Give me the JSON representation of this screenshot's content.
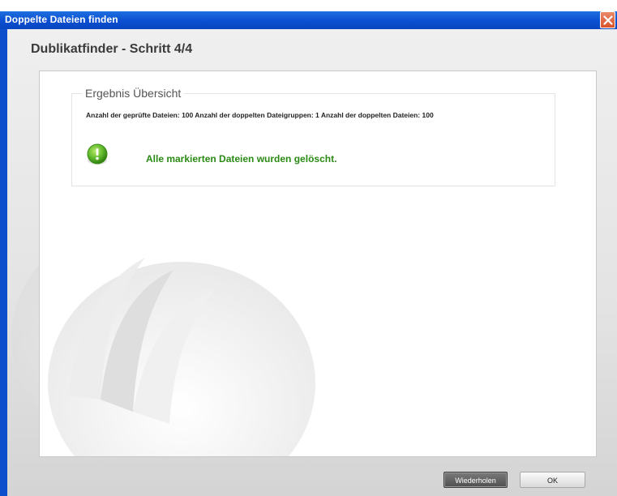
{
  "window": {
    "title": "Doppelte Dateien finden"
  },
  "wizard": {
    "heading": "Dublikatfinder - Schritt 4/4"
  },
  "result": {
    "legend": "Ergebnis Übersicht",
    "stats_text": "Anzahl der geprüfte Dateien: 100   Anzahl der doppelten Dateigruppen: 1   Anzahl der doppelten Dateien: 100",
    "status_message": "Alle markierten Dateien wurden gelöscht.",
    "status_icon": "exclamation-icon"
  },
  "buttons": {
    "repeat_label": "Wiederholen",
    "ok_label": "OK"
  },
  "colors": {
    "titlebar": "#0a4fd0",
    "success_text": "#2a8a14",
    "status_icon_green": "#5fb82a"
  }
}
